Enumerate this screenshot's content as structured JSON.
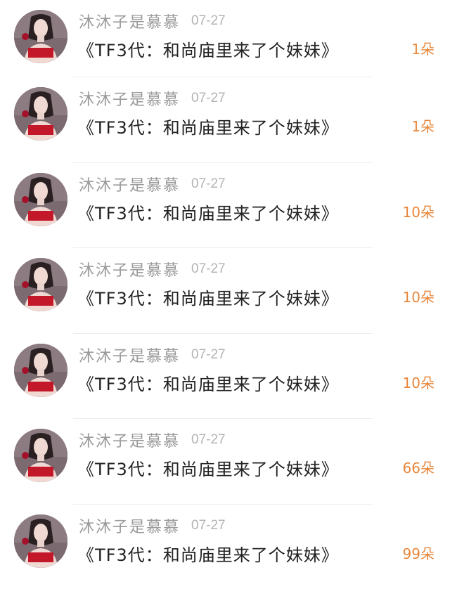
{
  "gift_list": {
    "items": [
      {
        "username": "沐沐子是慕慕",
        "date": "07-27",
        "title": "《TF3代：和尚庙里来了个妹妹》",
        "amount": "1朵"
      },
      {
        "username": "沐沐子是慕慕",
        "date": "07-27",
        "title": "《TF3代：和尚庙里来了个妹妹》",
        "amount": "1朵"
      },
      {
        "username": "沐沐子是慕慕",
        "date": "07-27",
        "title": "《TF3代：和尚庙里来了个妹妹》",
        "amount": "10朵"
      },
      {
        "username": "沐沐子是慕慕",
        "date": "07-27",
        "title": "《TF3代：和尚庙里来了个妹妹》",
        "amount": "10朵"
      },
      {
        "username": "沐沐子是慕慕",
        "date": "07-27",
        "title": "《TF3代：和尚庙里来了个妹妹》",
        "amount": "10朵"
      },
      {
        "username": "沐沐子是慕慕",
        "date": "07-27",
        "title": "《TF3代：和尚庙里来了个妹妹》",
        "amount": "66朵"
      },
      {
        "username": "沐沐子是慕慕",
        "date": "07-27",
        "title": "《TF3代：和尚庙里来了个妹妹》",
        "amount": "99朵"
      }
    ]
  },
  "colors": {
    "username": "#9a9a9a",
    "date": "#b3b3b3",
    "title": "#222222",
    "amount": "#e8863a"
  },
  "icons": {
    "avatar": "user-avatar-photo"
  }
}
